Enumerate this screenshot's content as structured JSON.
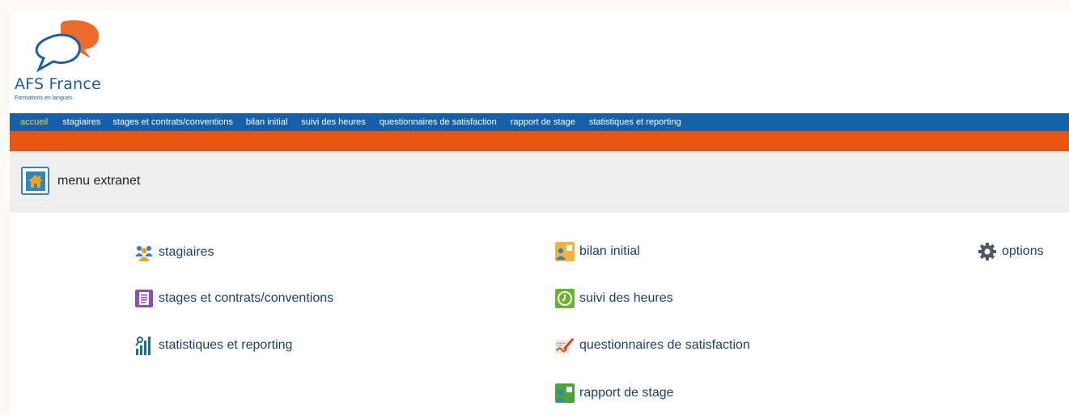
{
  "logo": {
    "brand": "AFS France",
    "tagline": "Formations en langues"
  },
  "nav": {
    "items": [
      {
        "label": "accueil",
        "active": true
      },
      {
        "label": "stagiaires"
      },
      {
        "label": "stages et contrats/conventions"
      },
      {
        "label": "bilan initial"
      },
      {
        "label": "suivi des heures"
      },
      {
        "label": "questionnaires de satisfaction"
      },
      {
        "label": "rapport de stage"
      },
      {
        "label": "statistiques et reporting"
      }
    ]
  },
  "header": {
    "title": "menu extranet",
    "icon": "home-icon"
  },
  "menu": {
    "col1": [
      {
        "label": "stagiaires",
        "icon": "users-icon"
      },
      {
        "label": "stages et contrats/conventions",
        "icon": "document-icon"
      },
      {
        "label": "statistiques et reporting",
        "icon": "bar-chart-icon"
      }
    ],
    "col2": [
      {
        "label": "bilan initial",
        "icon": "profile-card-icon"
      },
      {
        "label": "suivi des heures",
        "icon": "clock-icon"
      },
      {
        "label": "questionnaires de satisfaction",
        "icon": "signature-icon"
      },
      {
        "label": "rapport de stage",
        "icon": "report-card-icon"
      }
    ],
    "col3": [
      {
        "label": "options",
        "icon": "gear-icon"
      }
    ]
  },
  "colors": {
    "nav_blue": "#1560a8",
    "orange": "#e85614",
    "active_yellow": "#f2d230",
    "link_text": "#1b3f6e"
  }
}
